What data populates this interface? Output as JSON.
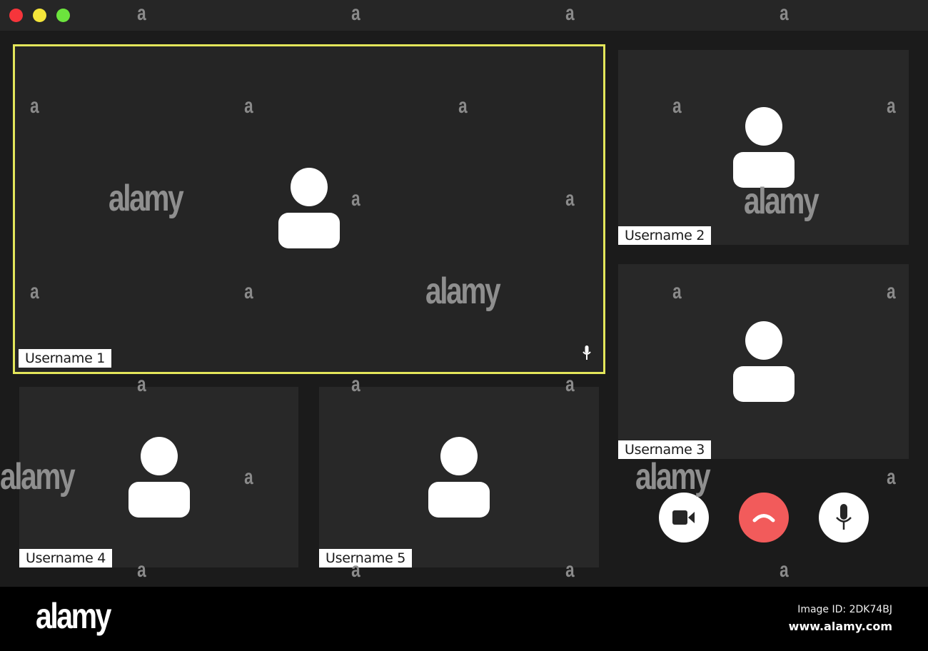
{
  "window": {
    "controls": [
      "close",
      "minimize",
      "maximize"
    ],
    "colors": {
      "close": "#f6353b",
      "minimize": "#f5e63a",
      "maximize": "#6ce43d",
      "active_speaker_border": "#e3e65a",
      "end_call": "#f25b5b"
    }
  },
  "participants": [
    {
      "name": "Username 1",
      "active_speaker": true,
      "mic_icon": "microphone-icon"
    },
    {
      "name": "Username 2",
      "active_speaker": false
    },
    {
      "name": "Username 3",
      "active_speaker": false
    },
    {
      "name": "Username 4",
      "active_speaker": false
    },
    {
      "name": "Username 5",
      "active_speaker": false
    }
  ],
  "controls": {
    "video": {
      "icon": "video-camera-icon"
    },
    "end_call": {
      "icon": "phone-hangup-icon"
    },
    "mute": {
      "icon": "microphone-icon"
    }
  },
  "watermark": {
    "text": "alamy",
    "letter": "a"
  },
  "footer": {
    "logo": "alamy",
    "image_id": "Image ID: 2DK74BJ",
    "url": "www.alamy.com"
  }
}
